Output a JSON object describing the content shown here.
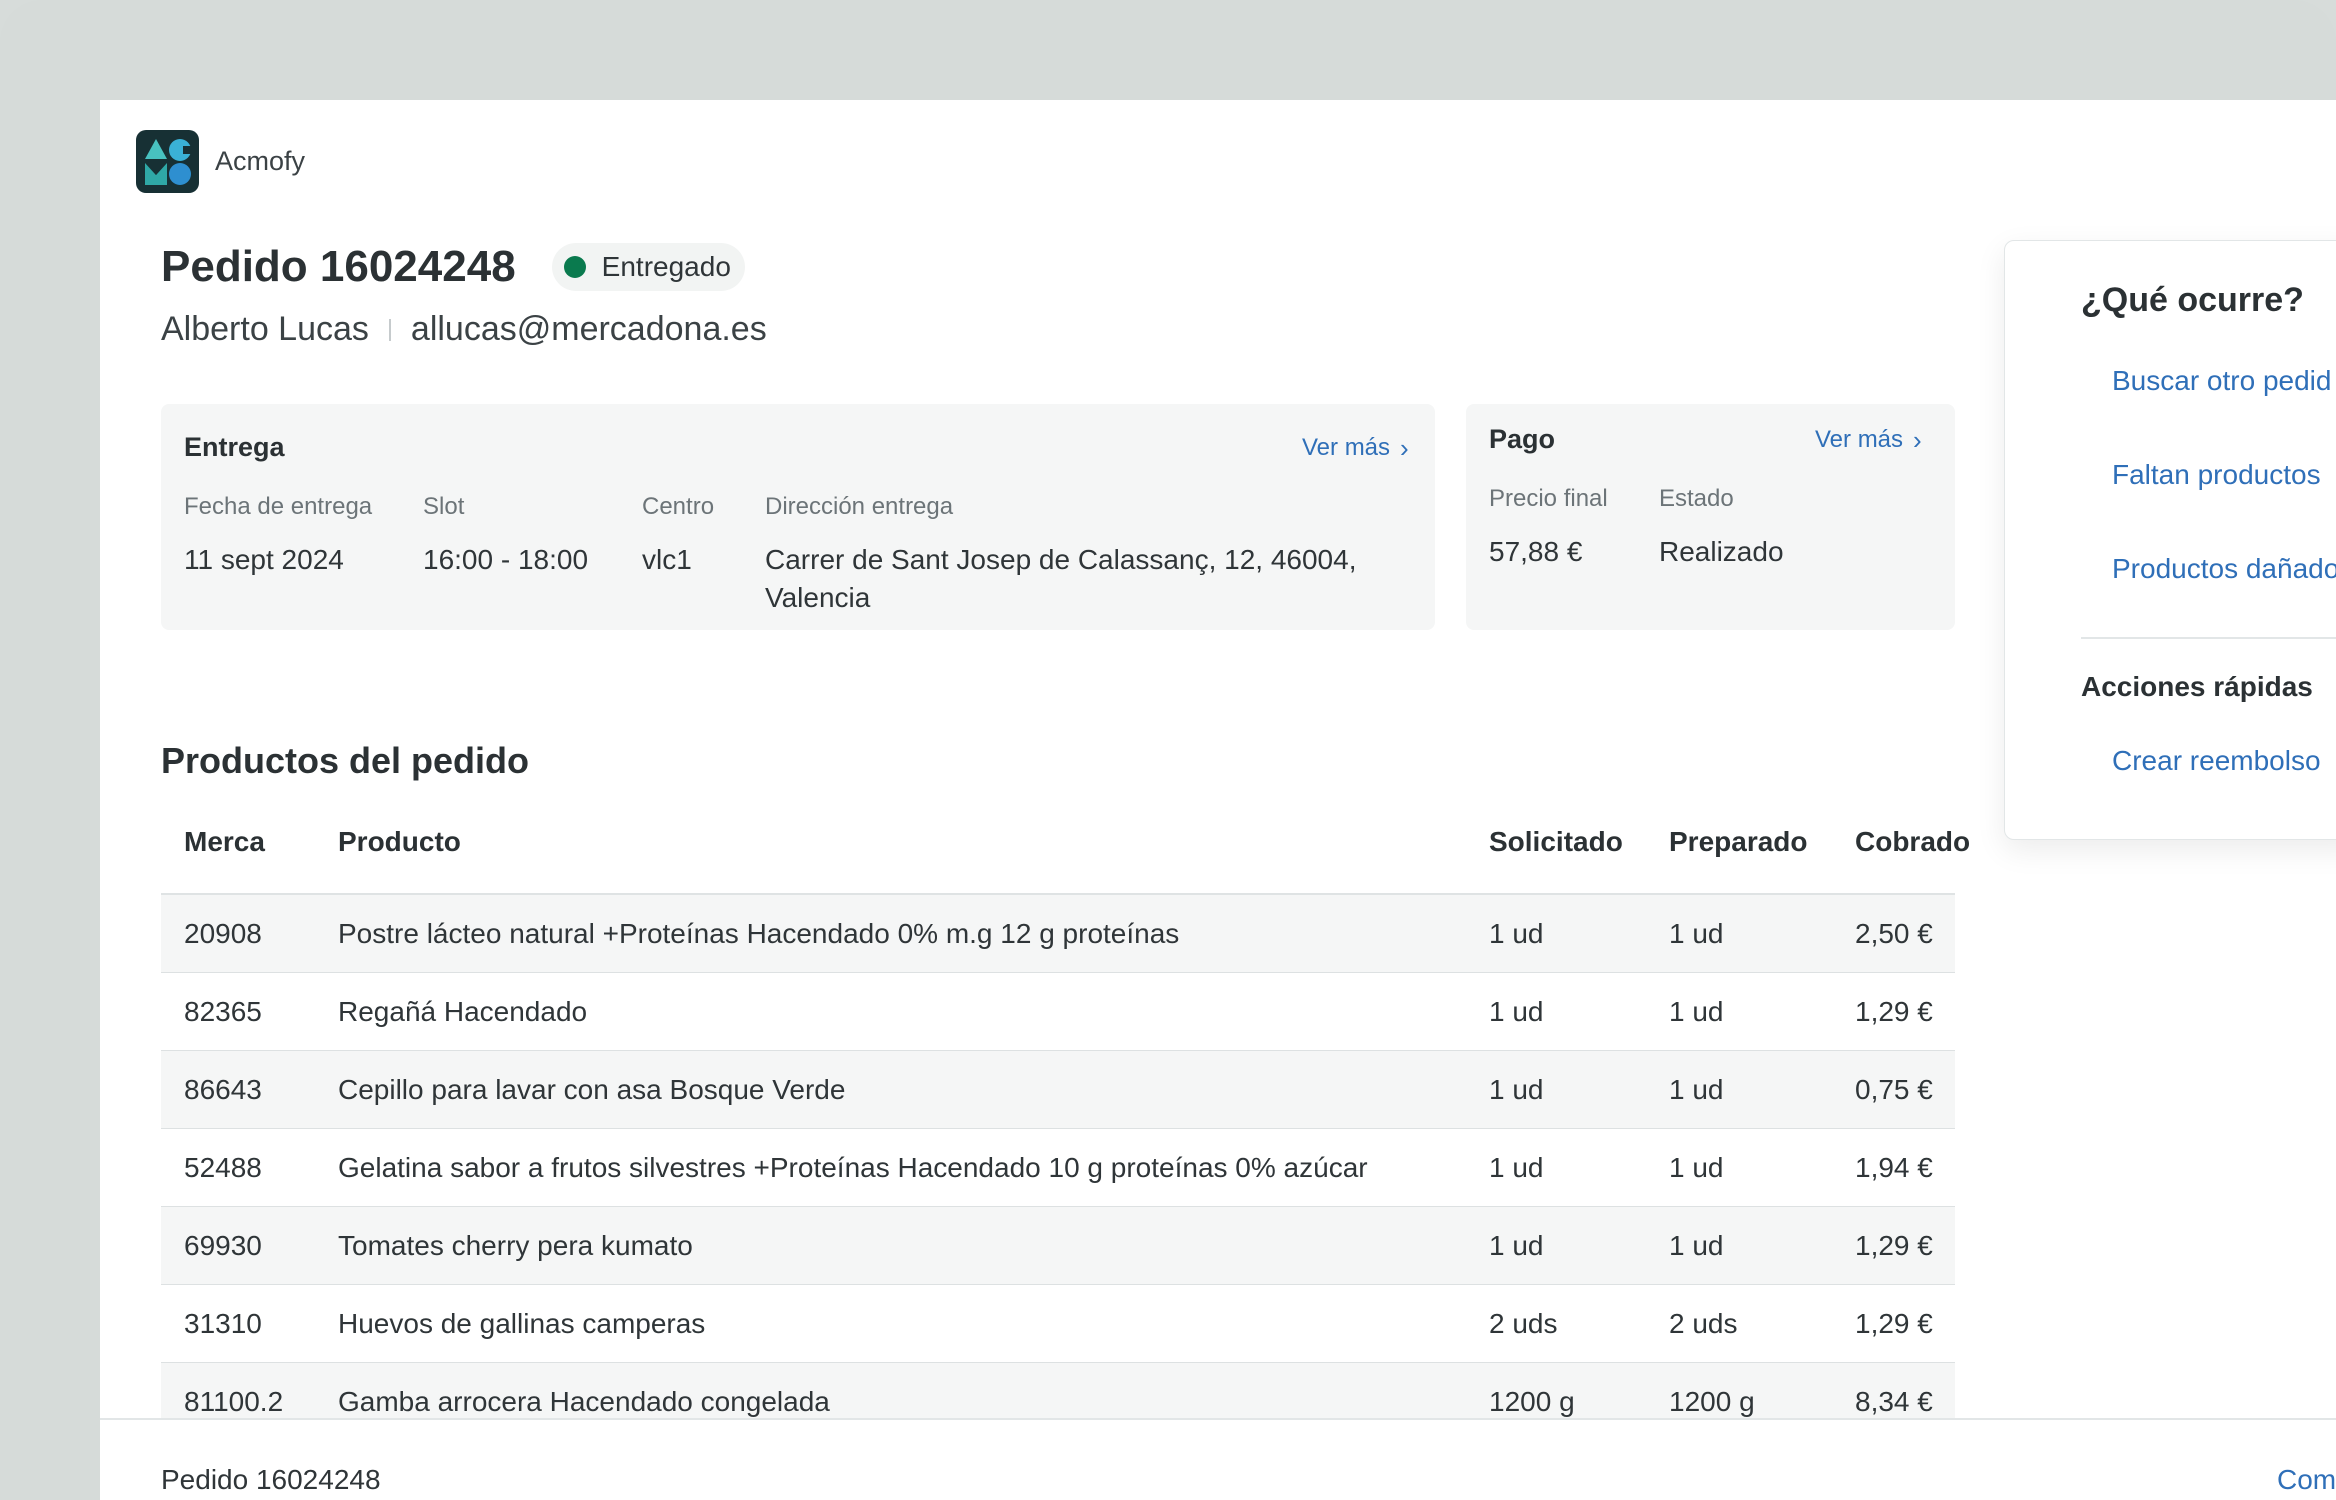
{
  "app": {
    "name": "Acmofy"
  },
  "order": {
    "title": "Pedido 16024248",
    "status": "Entregado",
    "status_color": "#0a7a4e",
    "customer_name": "Alberto Lucas",
    "customer_email": "allucas@mercadona.es"
  },
  "entrega": {
    "title": "Entrega",
    "link": "Ver más",
    "fields": [
      {
        "label": "Fecha de entrega",
        "value": "11 sept 2024"
      },
      {
        "label": "Slot",
        "value": "16:00 - 18:00"
      },
      {
        "label": "Centro",
        "value": "vlc1"
      },
      {
        "label": "Dirección entrega",
        "value": "Carrer de Sant Josep de Calassanç, 12, 46004, Valencia"
      }
    ]
  },
  "pago": {
    "title": "Pago",
    "link": "Ver más",
    "fields": [
      {
        "label": "Precio final",
        "value": "57,88 €"
      },
      {
        "label": "Estado",
        "value": "Realizado"
      }
    ]
  },
  "products": {
    "title": "Productos del pedido",
    "columns": [
      "Merca",
      "Producto",
      "Solicitado",
      "Preparado",
      "Cobrado"
    ],
    "rows": [
      [
        "20908",
        "Postre lácteo natural +Proteínas Hacendado 0% m.g 12 g proteínas",
        "1 ud",
        "1 ud",
        "2,50 €"
      ],
      [
        "82365",
        "Regañá Hacendado",
        "1 ud",
        "1 ud",
        "1,29 €"
      ],
      [
        "86643",
        "Cepillo para lavar con asa Bosque Verde",
        "1 ud",
        "1 ud",
        "0,75 €"
      ],
      [
        "52488",
        "Gelatina sabor a frutos silvestres +Proteínas Hacendado 10 g proteínas 0% azúcar",
        "1 ud",
        "1 ud",
        "1,94 €"
      ],
      [
        "69930",
        "Tomates cherry pera kumato",
        "1 ud",
        "1 ud",
        "1,29 €"
      ],
      [
        "31310",
        "Huevos de gallinas camperas",
        "2 uds",
        "2 uds",
        "1,29 €"
      ],
      [
        "81100.2",
        "Gamba arrocera Hacendado congelada",
        "1200 g",
        "1200 g",
        "8,34 €"
      ]
    ]
  },
  "side_panel": {
    "title": "¿Qué ocurre?",
    "links": [
      "Buscar otro pedid",
      "Faltan productos",
      "Productos dañado"
    ],
    "quick_actions_title": "Acciones rápidas",
    "quick_actions": [
      "Crear reembolso"
    ]
  },
  "footer": {
    "title": "Pedido 16024248",
    "action": "Com"
  }
}
